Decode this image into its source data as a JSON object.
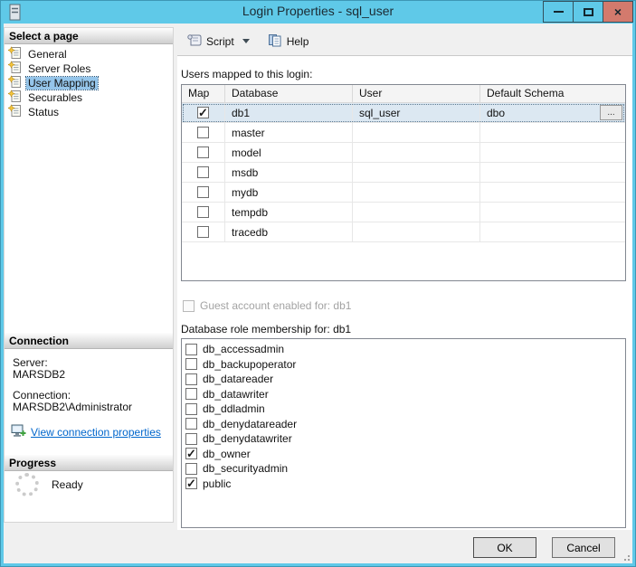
{
  "window": {
    "title": "Login Properties - sql_user"
  },
  "colors": {
    "titlebar": "#5fc9e8",
    "close_button": "#d37a6d",
    "row_selection": "#dce8f2",
    "sidebar_selection": "#95c5ea",
    "link": "#0066cc"
  },
  "sidebar": {
    "select_page": {
      "header": "Select a page",
      "items": [
        {
          "label": "General",
          "selected": false
        },
        {
          "label": "Server Roles",
          "selected": false
        },
        {
          "label": "User Mapping",
          "selected": true
        },
        {
          "label": "Securables",
          "selected": false
        },
        {
          "label": "Status",
          "selected": false
        }
      ]
    },
    "connection": {
      "header": "Connection",
      "server_label": "Server:",
      "server_value": "MARSDB2",
      "connection_label": "Connection:",
      "connection_value": "MARSDB2\\Administrator",
      "link_label": "View connection properties"
    },
    "progress": {
      "header": "Progress",
      "status": "Ready"
    }
  },
  "toolbar": {
    "script_label": "Script",
    "help_label": "Help"
  },
  "main": {
    "mapping_label": "Users mapped to this login:",
    "table": {
      "headers": [
        "Map",
        "Database",
        "User",
        "Default Schema"
      ],
      "rows": [
        {
          "map": true,
          "database": "db1",
          "user": "sql_user",
          "default_schema": "dbo",
          "selected": true,
          "browse": "..."
        },
        {
          "map": false,
          "database": "master",
          "user": "",
          "default_schema": ""
        },
        {
          "map": false,
          "database": "model",
          "user": "",
          "default_schema": ""
        },
        {
          "map": false,
          "database": "msdb",
          "user": "",
          "default_schema": ""
        },
        {
          "map": false,
          "database": "mydb",
          "user": "",
          "default_schema": ""
        },
        {
          "map": false,
          "database": "tempdb",
          "user": "",
          "default_schema": ""
        },
        {
          "map": false,
          "database": "tracedb",
          "user": "",
          "default_schema": ""
        }
      ]
    },
    "guest_checkbox_label": "Guest account enabled for: db1",
    "role_label": "Database role membership for: db1",
    "roles": [
      {
        "label": "db_accessadmin",
        "checked": false
      },
      {
        "label": "db_backupoperator",
        "checked": false
      },
      {
        "label": "db_datareader",
        "checked": false
      },
      {
        "label": "db_datawriter",
        "checked": false
      },
      {
        "label": "db_ddladmin",
        "checked": false
      },
      {
        "label": "db_denydatareader",
        "checked": false
      },
      {
        "label": "db_denydatawriter",
        "checked": false
      },
      {
        "label": "db_owner",
        "checked": true
      },
      {
        "label": "db_securityadmin",
        "checked": false
      },
      {
        "label": "public",
        "checked": true
      }
    ]
  },
  "footer": {
    "ok_label": "OK",
    "cancel_label": "Cancel"
  }
}
